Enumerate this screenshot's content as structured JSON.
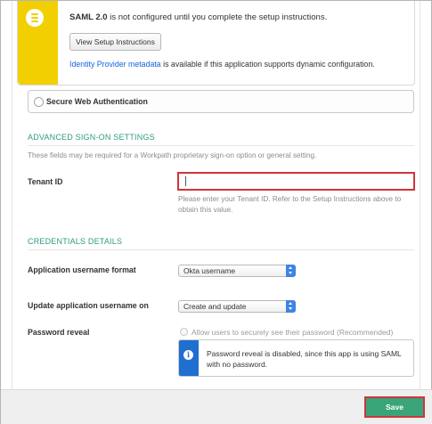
{
  "notice": {
    "bold": "SAML 2.0",
    "text": " is not configured until you complete the setup instructions.",
    "setup_button": "View Setup Instructions",
    "link": "Identity Provider metadata",
    "link_suffix": " is available if this application supports dynamic configuration.",
    "icon": "list-icon"
  },
  "swa_option": {
    "label": "Secure Web Authentication"
  },
  "advanced": {
    "title": "ADVANCED SIGN-ON SETTINGS",
    "hint": "These fields may be required for a Workpath proprietary sign-on option or general setting.",
    "tenant_label": "Tenant ID",
    "tenant_value": "",
    "tenant_help": "Please enter your Tenant ID. Refer to the Setup Instructions above to obtain this value."
  },
  "credentials": {
    "title": "CREDENTIALS DETAILS",
    "username_format_label": "Application username format",
    "username_format_value": "Okta username",
    "update_label": "Update application username on",
    "update_value": "Create and update",
    "password_reveal_label": "Password reveal",
    "password_reveal_checkbox": "Allow users to securely see their password (Recommended)",
    "info_text": "Password reveal is disabled, since this app is using SAML with no password.",
    "info_icon": "info-icon"
  },
  "footer": {
    "save_label": "Save"
  },
  "colors": {
    "accent_green": "#3da37b",
    "section_green": "#2e9b83",
    "notice_yellow": "#f2cf00",
    "info_blue": "#1f6fd0",
    "error_red": "#d0353a"
  }
}
